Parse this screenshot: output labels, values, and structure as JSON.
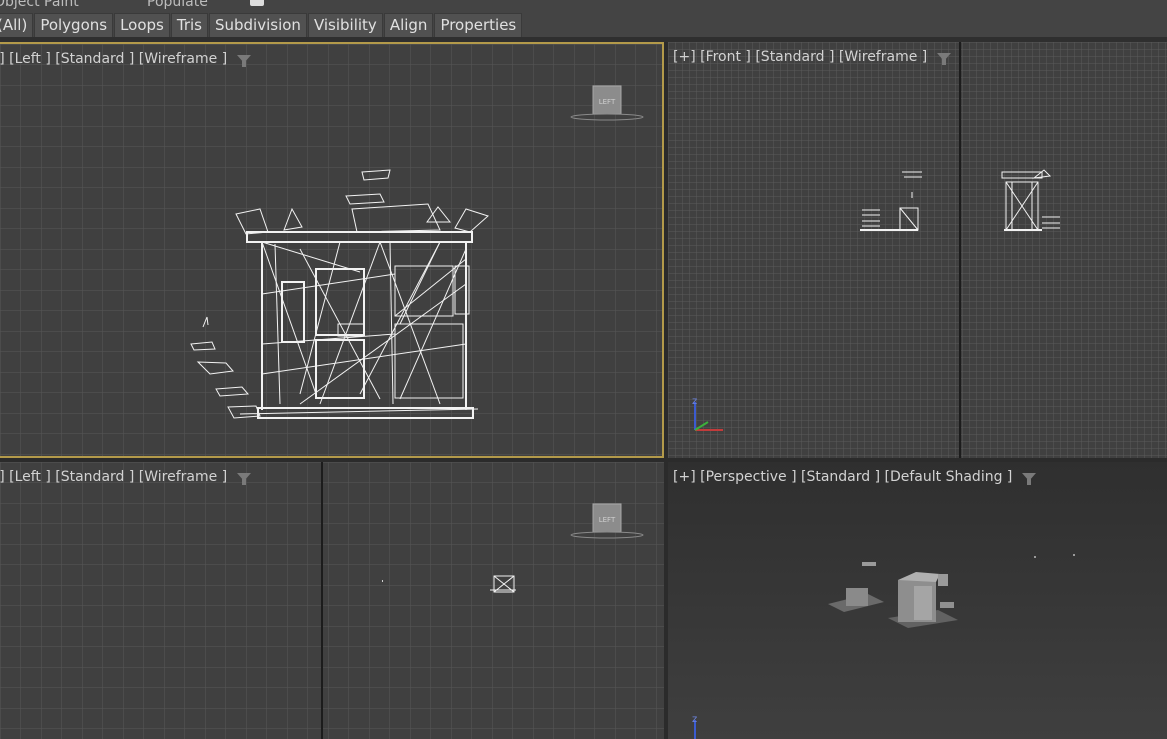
{
  "ribbon": {
    "top_labels": [
      "Object Paint",
      "Populate"
    ],
    "tabs": [
      "(All)",
      "Polygons",
      "Loops",
      "Tris",
      "Subdivision",
      "Visibility",
      "Align",
      "Properties"
    ]
  },
  "viewports": {
    "top_left": {
      "label": "[+] [Left ] [Standard ] [Wireframe ]",
      "viewcube": "LEFT"
    },
    "top_right": {
      "label": "[+] [Front ] [Standard ] [Wireframe ]"
    },
    "bottom_left": {
      "label": "[+] [Left ] [Standard ] [Wireframe ]",
      "viewcube": "LEFT"
    },
    "bottom_right": {
      "label": "[+] [Perspective ] [Standard ] [Default Shading ]"
    }
  },
  "colors": {
    "viewport_bg": "#404040",
    "perspective_bg": "#3a3a3a",
    "active_border": "#b39a4a",
    "grid_line": "#575757"
  },
  "icons": [
    "filter-icon",
    "viewcube-icon",
    "axis-gizmo-icon"
  ]
}
